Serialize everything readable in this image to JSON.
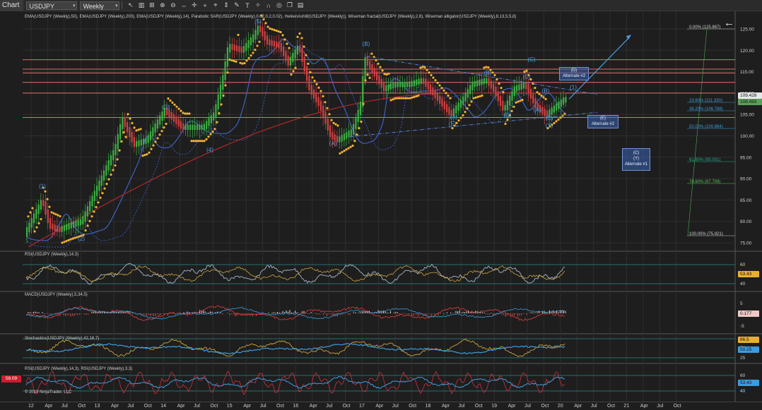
{
  "toolbar": {
    "chart_label": "Chart",
    "instrument": "USDJPY",
    "period": "Weekly",
    "icons": [
      "cursor-icon",
      "pointer-icon",
      "bars-icon",
      "zoom-in-icon",
      "zoom-out-icon",
      "pan-icon",
      "crosshair-icon",
      "add-icon",
      "pin-icon",
      "scroll-icon",
      "draw-icon",
      "text-icon",
      "wand-icon",
      "magnet-icon",
      "target-icon",
      "copy-icon",
      "panel-icon"
    ]
  },
  "panels": {
    "main_title": "EMA(USDJPY (Weekly),50), EMA(USDJPY (Weekly),200), EMA(USDJPY (Weekly),14), Parabolic SAR(USDJPY (Weekly),0.02,0.2,0.02), HeikenAshi8(USDJPY (Weekly)), Wiseman fractal(USDJPY (Weekly),2,8), Wiseman alligator(USDJPY (Weekly),8,13,5,5,8)",
    "rsi_title": "RSI(USDJPY (Weekly),14,3)",
    "macd_title": "MACD(USDJPY (Weekly),5,34,5)",
    "stoch_title": "Stochastics(USDJPY (Weekly),42,18,7)",
    "rsi2_title": "RSI(USDJPY (Weekly),14,3), RSI(USDJPY (Weekly),3,3)",
    "copyright": "© 2019 NinjaTrader, LLC"
  },
  "price_axis": {
    "ticks": [
      "125.00",
      "120.00",
      "115.00",
      "110.00",
      "105.00",
      "100.00",
      "95.00",
      "90.00",
      "85.00",
      "80.00",
      "75.00"
    ],
    "last_price": "109.428",
    "sub_price": "108.493"
  },
  "fib_levels": [
    {
      "label": "0.00% (125.867)",
      "color": "#d0d0d0"
    },
    {
      "label": "23.60% (111.330)",
      "color": "#3c9cdc"
    },
    {
      "label": "38.20% (106.788)",
      "color": "#3c9cdc"
    },
    {
      "label": "50.00% (100.894)",
      "color": "#3c9cdc"
    },
    {
      "label": "61.80% (95.001)",
      "color": "#1fae8c"
    },
    {
      "label": "78.60% (87.709)",
      "color": "#5cc15c"
    },
    {
      "label": "100.00% (75.921)",
      "color": "#d0d0d0"
    }
  ],
  "wave_labels": [
    "(1)",
    "(2)",
    "(3)",
    "(4)",
    "(5)",
    "(A)",
    "(B)",
    "(A)",
    "(B)",
    "(C)",
    "(D)",
    "(E)",
    "(A)",
    "(B)",
    "(C)",
    "(1)",
    "(C)",
    "(Y)"
  ],
  "alternates": [
    {
      "wave": "(D)",
      "label": "Alternate #2"
    },
    {
      "wave": "(E)",
      "label": "Alternate #2"
    },
    {
      "wave": "(C)",
      "wave2": "(Y)",
      "label": "Alternate #1"
    }
  ],
  "rsi": {
    "ticks": [
      "60",
      "40"
    ],
    "value": "53.43"
  },
  "macd": {
    "ticks": [
      "5",
      "0",
      "-5"
    ],
    "value": "0.177"
  },
  "stoch": {
    "ticks": [
      "75",
      "50",
      "25"
    ],
    "value_k": "86.5",
    "value_d": "50.25"
  },
  "rsi2": {
    "ticks": [
      "60",
      "40"
    ],
    "value": "53.43",
    "value_fast": "58.09"
  },
  "x_axis": [
    "12",
    "Apr",
    "Jul",
    "Oct",
    "13",
    "Apr",
    "Jul",
    "Oct",
    "14",
    "Apr",
    "Jul",
    "Oct",
    "15",
    "Apr",
    "Jul",
    "Oct",
    "16",
    "Apr",
    "Jul",
    "Oct",
    "17",
    "Apr",
    "Jul",
    "Oct",
    "18",
    "Apr",
    "Jul",
    "Oct",
    "19",
    "Apr",
    "Jul",
    "Oct",
    "20",
    "Apr",
    "Jul",
    "Oct",
    "21",
    "Apr",
    "Jul",
    "Oct"
  ],
  "colors": {
    "background": "#1e1e1e",
    "grid": "#2e2e2e",
    "sar": "#f0b030",
    "ema50": "#d43a3a",
    "ema200": "#b02828",
    "ema14": "#4060c0",
    "bull": "#3cb043",
    "bear": "#d04040",
    "wave": "#4a9ee8",
    "horizontal": "#e07070"
  }
}
